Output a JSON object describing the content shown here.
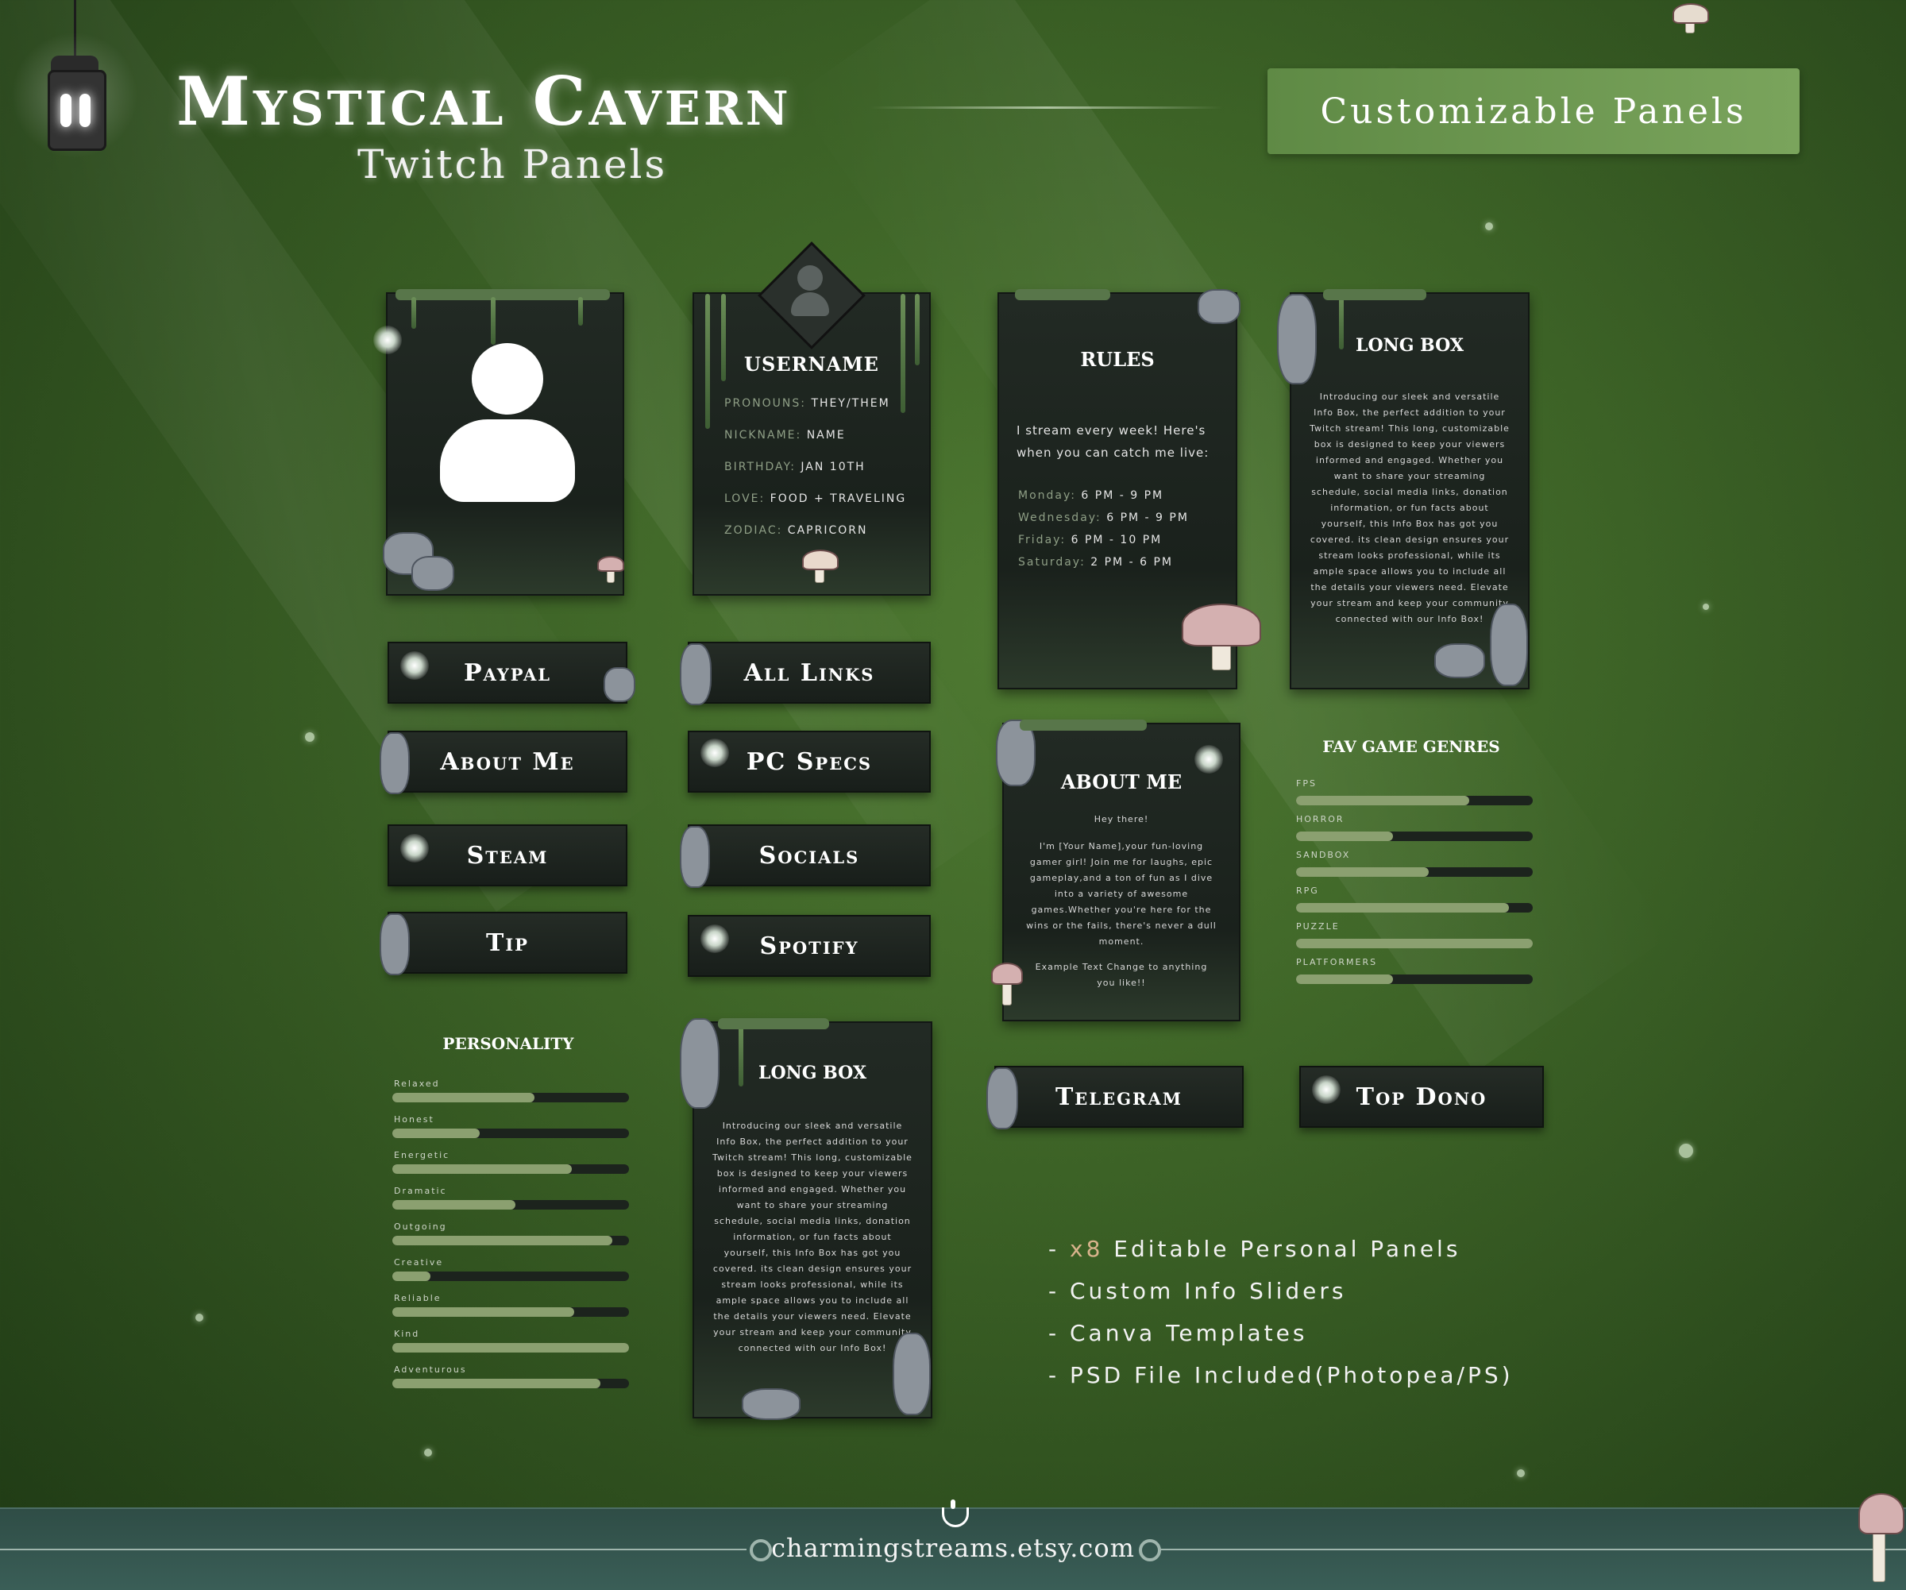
{
  "header": {
    "title": "Mystical Cavern",
    "subtitle": "Twitch Panels",
    "badge": "Customizable Panels"
  },
  "profile_card": {
    "username": "USERNAME",
    "rows": [
      {
        "key": "PRONOUNS:",
        "value": "THEY/THEM"
      },
      {
        "key": "NICKNAME:",
        "value": "NAME"
      },
      {
        "key": "BIRTHDAY:",
        "value": "JAN 10TH"
      },
      {
        "key": "LOVE:",
        "value": "FOOD + TRAVELING"
      },
      {
        "key": "ZODIAC:",
        "value": "CAPRICORN"
      }
    ]
  },
  "rules_card": {
    "title": "RULES",
    "intro": "I stream every week! Here's when you can catch me live:",
    "schedule": [
      {
        "day": "Monday:",
        "time": "6 PM - 9 PM"
      },
      {
        "day": "Wednesday:",
        "time": "6 PM - 9 PM"
      },
      {
        "day": "Friday:",
        "time": "6 PM - 10 PM"
      },
      {
        "day": "Saturday:",
        "time": "2 PM - 6 PM"
      }
    ]
  },
  "long_box": {
    "title": "LONG BOX",
    "body": "Introducing our sleek and versatile Info Box, the perfect addition to your Twitch stream! This long, customizable box is designed to keep your viewers informed and engaged. Whether you want to share your streaming schedule, social media links, donation information, or fun facts about yourself, this Info Box has got you covered. its clean design ensures your stream looks professional, while its ample space allows you to include all the details your viewers need. Elevate your stream and keep your community connected with our Info Box!"
  },
  "about_card": {
    "title": "ABOUT ME",
    "greeting": "Hey there!",
    "body": "I'm [Your Name],your fun-loving gamer girl! Join me for laughs, epic gameplay,and a ton of fun as I dive into a variety of awesome games.Whether you're here for the wins or the fails, there's never a dull moment.",
    "footer": "Example Text Change to anything you like!!"
  },
  "buttons": {
    "paypal": "Paypal",
    "all_links": "All Links",
    "about_me": "About Me",
    "pc_specs": "PC Specs",
    "steam": "Steam",
    "socials": "Socials",
    "tip": "Tip",
    "spotify": "Spotify",
    "telegram": "Telegram",
    "top_dono": "Top Dono"
  },
  "genres": {
    "title": "FAV GAME GENRES",
    "items": [
      {
        "label": "FPS",
        "value": 0.73
      },
      {
        "label": "HORROR",
        "value": 0.41
      },
      {
        "label": "SANDBOX",
        "value": 0.56
      },
      {
        "label": "RPG",
        "value": 0.9
      },
      {
        "label": "PUZZLE",
        "value": 1.0
      },
      {
        "label": "PLATFORMERS",
        "value": 0.41
      }
    ]
  },
  "personality": {
    "title": "PERSONALITY",
    "items": [
      {
        "label": "Relaxed",
        "value": 0.6
      },
      {
        "label": "Honest",
        "value": 0.37
      },
      {
        "label": "Energetic",
        "value": 0.76
      },
      {
        "label": "Dramatic",
        "value": 0.52
      },
      {
        "label": "Outgoing",
        "value": 0.93
      },
      {
        "label": "Creative",
        "value": 0.16
      },
      {
        "label": "Reliable",
        "value": 0.77
      },
      {
        "label": "Kind",
        "value": 1.0
      },
      {
        "label": "Adventurous",
        "value": 0.88
      }
    ]
  },
  "features": {
    "line1_prefix": "- ",
    "line1_accent": "x8",
    "line1_rest": " Editable Personal Panels",
    "line2": "- Custom Info Sliders",
    "line3": "- Canva Templates",
    "line4": "- PSD File Included(Photopea/PS)"
  },
  "footer": {
    "url": "charmingstreams.etsy.com"
  },
  "colors": {
    "background": "#3c6226",
    "badge": "#6e9a52",
    "panel": "#1f2621",
    "slider_fill": "#8ba070",
    "accent_text": "#d9b38c"
  }
}
